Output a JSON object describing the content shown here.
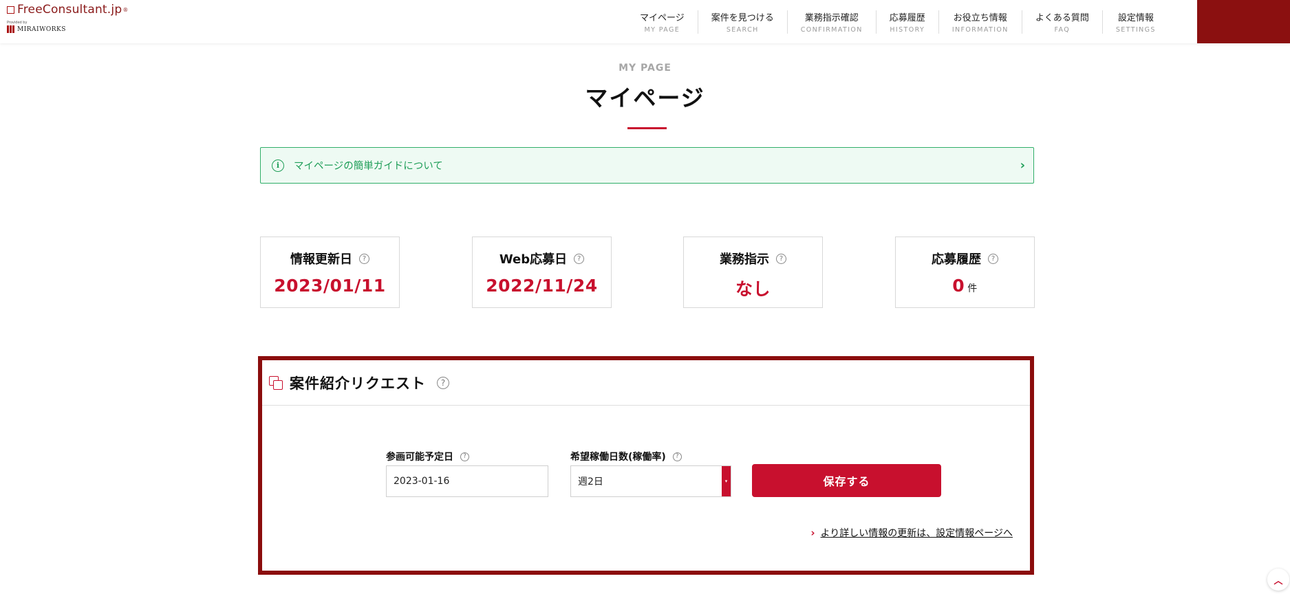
{
  "brand": {
    "logo_text": "FreeConsultant.jp",
    "logo_mark": "®",
    "provided_by": "Provided by",
    "company": "MIRAIWORKS"
  },
  "nav": [
    {
      "jp": "マイページ",
      "en": "MY PAGE"
    },
    {
      "jp": "案件を見つける",
      "en": "SEARCH"
    },
    {
      "jp": "業務指示確認",
      "en": "CONFIRMATION"
    },
    {
      "jp": "応募履歴",
      "en": "HISTORY"
    },
    {
      "jp": "お役立ち情報",
      "en": "INFORMATION"
    },
    {
      "jp": "よくある質問",
      "en": "FAQ"
    },
    {
      "jp": "設定情報",
      "en": "SETTINGS"
    }
  ],
  "page": {
    "title_en": "MY PAGE",
    "title": "マイページ"
  },
  "guide": {
    "text": "マイページの簡単ガイドについて"
  },
  "stats": [
    {
      "label": "情報更新日",
      "value": "2023/01/11",
      "unit": ""
    },
    {
      "label": "Web応募日",
      "value": "2022/11/24",
      "unit": ""
    },
    {
      "label": "業務指示",
      "value": "なし",
      "unit": ""
    },
    {
      "label": "応募履歴",
      "value": "0",
      "unit": "件"
    }
  ],
  "request": {
    "title": "案件紹介リクエスト",
    "date_label": "参画可能予定日",
    "date_value": "2023-01-16",
    "days_label": "希望稼働日数(稼働率)",
    "days_value": "週2日",
    "save_label": "保存する",
    "detail_link": "より詳しい情報の更新は、設定情報ページへ"
  },
  "icons": {
    "question": "?",
    "info": "i",
    "chevron": "›",
    "caret": "▾",
    "up": "︿"
  },
  "colors": {
    "accent": "#c8102e",
    "header_block": "#8b1010",
    "guide_green": "#1f9e58"
  }
}
